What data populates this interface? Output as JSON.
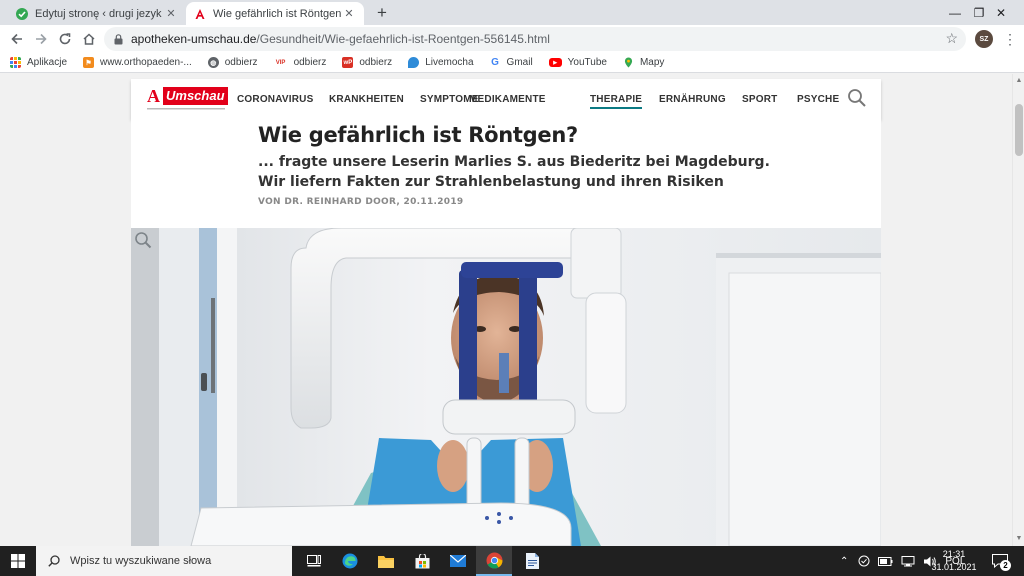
{
  "browser": {
    "tabs": [
      {
        "title": "Edytuj stronę ‹ drugi jezyk - niem",
        "active": false,
        "close": "✕"
      },
      {
        "title": "Wie gefährlich ist Röntgen? | Apo",
        "active": true,
        "close": "✕"
      }
    ],
    "new_tab": "+",
    "window_controls": {
      "minimize": "—",
      "maximize": "❐",
      "close": "✕"
    },
    "url_host": "apotheken-umschau.de",
    "url_path": "/Gesundheit/Wie-gefaehrlich-ist-Roentgen-556145.html",
    "profile_initials": "SZ",
    "bookmarks": [
      {
        "label": "Aplikacje",
        "icon": "apps-grid-icon"
      },
      {
        "label": "www.orthopaeden-...",
        "icon": "runner-icon"
      },
      {
        "label": "odbierz",
        "icon": "globe-icon"
      },
      {
        "label": "odbierz",
        "icon": "wp-icon"
      },
      {
        "label": "odbierz",
        "icon": "wp-red-icon"
      },
      {
        "label": "Livemocha",
        "icon": "livemocha-icon"
      },
      {
        "label": "Gmail",
        "icon": "google-icon"
      },
      {
        "label": "YouTube",
        "icon": "youtube-icon"
      },
      {
        "label": "Mapy",
        "icon": "maps-pin-icon"
      }
    ]
  },
  "site": {
    "logo_text": "Umschau",
    "nav": [
      {
        "label": "CORONAVIRUS",
        "active": false
      },
      {
        "label": "KRANKHEITEN",
        "active": false
      },
      {
        "label": "SYMPTOME",
        "active": false
      },
      {
        "label": "MEDIKAMENTE",
        "active": false
      },
      {
        "label": "THERAPIE",
        "active": true
      },
      {
        "label": "ERNÄHRUNG",
        "active": false
      },
      {
        "label": "SPORT",
        "active": false
      },
      {
        "label": "PSYCHE",
        "active": false
      }
    ],
    "accent_color": "#0b7a83",
    "brand_color": "#e2001a"
  },
  "article": {
    "headline": "Wie gefährlich ist Röntgen?",
    "teaser": "... fragte unsere Leserin Marlies S. aus Biederitz bei Magdeburg. Wir liefern Fakten zur Strahlenbelastung und ihren Risiken",
    "byline": "VON DR. REINHARD DOOR, 20.11.2019"
  },
  "taskbar": {
    "search_placeholder": "Wpisz tu wyszukiwane słowa",
    "language": "POL",
    "time": "21:31",
    "date": "31.01.2021",
    "notification_count": "2"
  }
}
